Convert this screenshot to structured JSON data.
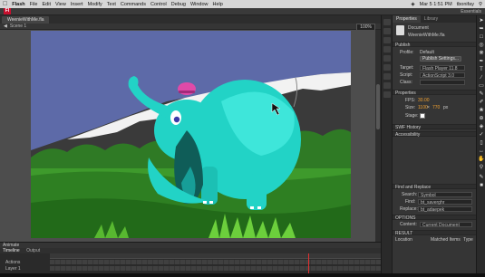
{
  "menubar": {
    "app_name": "Flash",
    "items": [
      "File",
      "Edit",
      "View",
      "Insert",
      "Modify",
      "Text",
      "Commands",
      "Control",
      "Debug",
      "Window",
      "Help"
    ],
    "clock": "Mar 5  1:51 PM",
    "user": "tbonifay"
  },
  "appbar": {
    "logo": "Fl",
    "workspace": "Essentials"
  },
  "document": {
    "tab_name": "WeenieWithMe.fla",
    "scene_label": "Scene 1",
    "zoom": "100%"
  },
  "panel": {
    "tabs": [
      "Properties",
      "Library"
    ],
    "doc_type": "Document",
    "doc_name": "WeenieWithMe.fla",
    "publish_header": "Publish",
    "profile_label": "Profile:",
    "profile_value": "Default",
    "publish_settings_button": "Publish Settings...",
    "target_label": "Target:",
    "target_value": "Flash Player 11.8",
    "script_label": "Script:",
    "script_value": "ActionScript 3.0",
    "class_label": "Class:",
    "properties_header": "Properties",
    "fps_label": "FPS:",
    "fps_value": "30.00",
    "size_label": "Size:",
    "width_value": "1100",
    "height_value": "770",
    "unit": "px",
    "stage_label": "Stage:",
    "swf_history_header": "SWF History",
    "accessibility_header": "Accessibility",
    "find_replace_header": "Find and Replace",
    "search_label": "Search:",
    "search_value": "Symbol",
    "find_label": "Find:",
    "find_value": "bt_saverghr",
    "replace_label": "Replace:",
    "replace_value": "bt_adaepek",
    "options_header": "OPTIONS",
    "content_label": "Content:",
    "content_value": "Current Document",
    "results_header": "RESULT",
    "results_columns": [
      "Location",
      "Matched Items",
      "Type"
    ]
  },
  "timeline": {
    "title": "Animate",
    "tabs": [
      "Timeline",
      "Output"
    ],
    "layers": [
      "Actions",
      "Layer 1"
    ]
  },
  "colors": {
    "sky": "#5d6aa8",
    "mountain": "#3c3c3c",
    "snow": "#f2f2f2",
    "grass_dark": "#2f7a25",
    "grass_light": "#6ccf3c",
    "elephant": "#22d3c6",
    "elephant_dark": "#179e98",
    "hat": "#e04aa8",
    "playhead": "#e03030"
  }
}
